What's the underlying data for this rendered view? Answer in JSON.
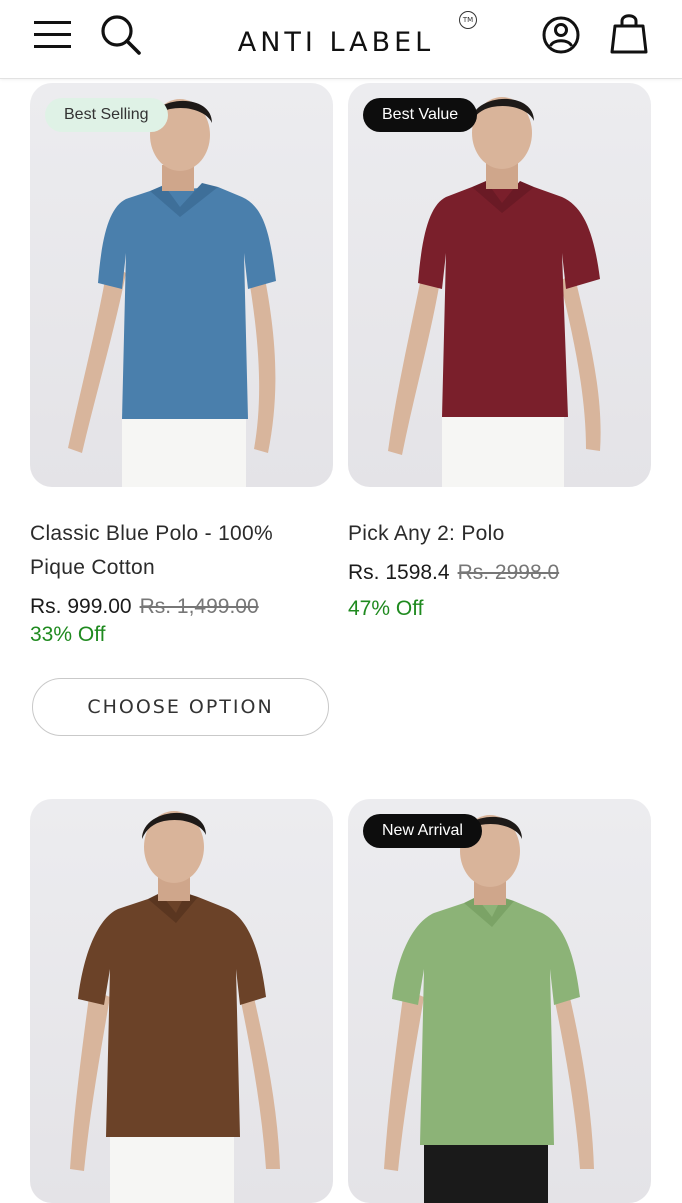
{
  "header": {
    "brand": "ANTI LABEL",
    "trademark": "TM",
    "icons": [
      "menu-icon",
      "search-icon",
      "account-icon",
      "shopping-bag-icon"
    ]
  },
  "products": [
    {
      "badge": "Best Selling",
      "shirt_color": "#4a7fac",
      "title_line1": "Classic Blue Polo - 100%",
      "title_line2": "Pique Cotton",
      "price": "Rs. 999.00",
      "old_price": "Rs. 1,499.00",
      "discount": "33% Off",
      "button": "CHOOSE OPTION"
    },
    {
      "badge": "Best Value",
      "shirt_color": "#7a1f2b",
      "title_line1": "Pick Any 2: Polo",
      "price": "Rs. 1598.4",
      "old_price": "Rs. 2998.0",
      "discount": "47% Off"
    },
    {
      "shirt_color": "#6b4228"
    },
    {
      "badge": "New Arrival",
      "shirt_color": "#8cb377"
    }
  ],
  "colors": {
    "discount": "#1f8a1f",
    "badge_light": "#dff2e6",
    "badge_dark": "#0d0d0d"
  }
}
